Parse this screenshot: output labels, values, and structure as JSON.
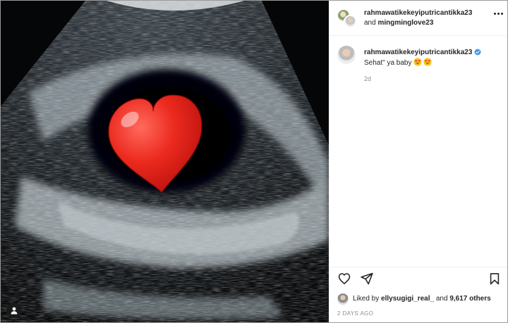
{
  "media": {
    "description_icons": [
      "heart-sticker",
      "user-tag-icon"
    ]
  },
  "header": {
    "author": "rahmawatikekeyiputricantikka23",
    "and_text": "and",
    "collaborator": "mingminglove23",
    "more_icon": "more-horizontal-icon"
  },
  "caption": {
    "username": "rahmawatikekeyiputricantikka23",
    "verified_icon": "verified-badge-icon",
    "text": "Sehat\" ya baby",
    "emojis": [
      "smiling-face-with-heart-eyes",
      "smiling-face-with-heart-eyes"
    ],
    "time": "2d"
  },
  "actions": {
    "like_icon": "heart-outline-icon",
    "share_icon": "paper-plane-icon",
    "save_icon": "bookmark-icon"
  },
  "likes": {
    "prefix": "Liked by",
    "user": "ellysugigi_real_",
    "and_text": "and",
    "count": "9,617 others"
  },
  "timestamp": "2 DAYS AGO",
  "colors": {
    "text": "#262626",
    "muted": "#8e8e8e",
    "verified": "#3897f0",
    "heart": "#e0241b"
  }
}
